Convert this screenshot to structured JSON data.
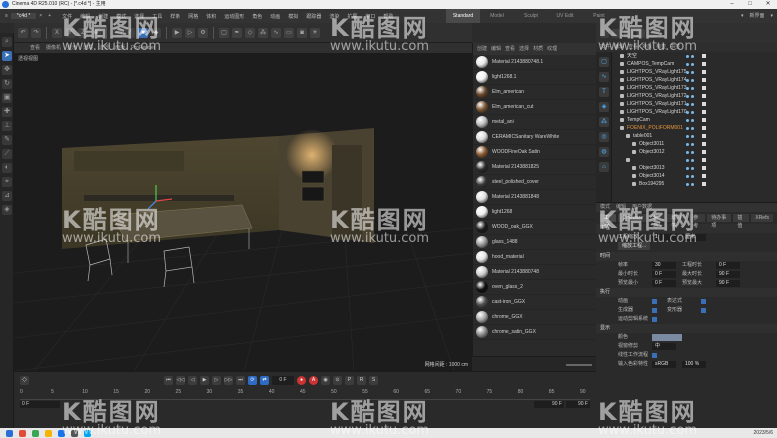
{
  "window": {
    "title": "Cinema 4D R25.010 (RC) - [*.c4d *] - 主用",
    "controls": [
      "–",
      "□",
      "✕"
    ]
  },
  "menubar": {
    "doc_tabs": [
      "≡",
      "*c4d *",
      "×",
      "+"
    ],
    "menus": [
      "文件",
      "编辑",
      "创建",
      "模式",
      "选择",
      "工具",
      "样条",
      "网格",
      "体积",
      "运动图形",
      "角色",
      "动画",
      "模拟",
      "跟踪器",
      "渲染",
      "扩展",
      "窗口",
      "帮助"
    ],
    "layouts": [
      "Standard",
      "Model",
      "Sculpt",
      "UV Edit",
      "Paint"
    ],
    "active_layout": "Standard",
    "right": [
      "▾",
      "新界面",
      "▾"
    ]
  },
  "toolbar": {
    "icons": [
      "cube-icon",
      "pen-icon",
      "subdivision-icon",
      "cloner-icon",
      "deformer-icon",
      "floor-icon",
      "camera-icon",
      "light-icon",
      "tag-icon",
      "render-icon",
      "render-view-icon",
      "render-settings-icon"
    ]
  },
  "viewport": {
    "menu": [
      "查看",
      "摄像机",
      "显示",
      "选项",
      "过滤",
      "面板",
      "ProRender"
    ],
    "label": "透视视图",
    "scale_text": "网格间距 : 1000 cm"
  },
  "material_manager": {
    "menu": [
      "创建",
      "编辑",
      "查看",
      "选择",
      "材质",
      "纹理"
    ],
    "materials": [
      {
        "name": "Material 2143880748.1",
        "color": "#e8e8e8"
      },
      {
        "name": "light1268.1",
        "color": "#f2f2f2"
      },
      {
        "name": "Elm_american",
        "color": "#6b4a2b"
      },
      {
        "name": "Elm_american_cut",
        "color": "#7a5634"
      },
      {
        "name": "metal_ani",
        "color": "#bdbdbd"
      },
      {
        "name": "CERAMICSanitary WareWhite",
        "color": "#dcdcdc"
      },
      {
        "name": "WOODFineOak Satin",
        "color": "#8a5a32"
      },
      {
        "name": "Material 2143881825",
        "color": "#2c2c2c"
      },
      {
        "name": "steel_polished_cover",
        "color": "#3a3a3a"
      },
      {
        "name": "Material 2143881848",
        "color": "#e0e0e0"
      },
      {
        "name": "light1268",
        "color": "#f0f0f0"
      },
      {
        "name": "WOOD_oak_GGX",
        "color": "#1d1d1d"
      },
      {
        "name": "glass_1488",
        "color": "#999999"
      },
      {
        "name": "hood_material",
        "color": "#e4e4e4"
      },
      {
        "name": "Material 2143880748",
        "color": "#cfcfcf"
      },
      {
        "name": "oven_glass_2",
        "color": "#111111"
      },
      {
        "name": "cast-iron_GGX",
        "color": "#505050"
      },
      {
        "name": "chrome_GGX",
        "color": "#a8a8a8"
      },
      {
        "name": "chrome_satin_GGX",
        "color": "#8c8c8c"
      }
    ]
  },
  "object_manager": {
    "menu": [
      "文件",
      "编辑",
      "查看",
      "对象",
      "标签",
      "书签"
    ],
    "objects": [
      {
        "name": "天空",
        "indent": 0,
        "orange": false
      },
      {
        "name": "CAMPOS_TempCam",
        "indent": 0,
        "orange": false
      },
      {
        "name": "LIGHTPOS_VRayLight175",
        "indent": 0,
        "orange": false
      },
      {
        "name": "LIGHTPOS_VRayLight174",
        "indent": 0,
        "orange": false
      },
      {
        "name": "LIGHTPOS_VRayLight173",
        "indent": 0,
        "orange": false
      },
      {
        "name": "LIGHTPOS_VRayLight172",
        "indent": 0,
        "orange": false
      },
      {
        "name": "LIGHTPOS_VRayLight171",
        "indent": 0,
        "orange": false
      },
      {
        "name": "LIGHTPOS_VRayLight170",
        "indent": 0,
        "orange": false
      },
      {
        "name": "TempCam",
        "indent": 0,
        "orange": false
      },
      {
        "name": "FOENIX_POLIFORM001",
        "indent": 0,
        "orange": true
      },
      {
        "name": "table001",
        "indent": 1,
        "orange": false
      },
      {
        "name": "Object3011",
        "indent": 2,
        "orange": false
      },
      {
        "name": "Object3012",
        "indent": 2,
        "orange": false
      },
      {
        "name": "",
        "indent": 1,
        "orange": false
      },
      {
        "name": "Object3013",
        "indent": 2,
        "orange": false
      },
      {
        "name": "Object3014",
        "indent": 2,
        "orange": false
      },
      {
        "name": "Box194295",
        "indent": 2,
        "orange": false
      }
    ]
  },
  "attributes": {
    "mode_menu": [
      "模式",
      "编辑",
      "用户数据"
    ],
    "tabs": [
      "工程",
      "Cineware",
      "信息",
      "动力学",
      "参考",
      "待办事项",
      "插值",
      "XRefs"
    ],
    "active_tab": "工程",
    "section_project": "工程",
    "project_scale_label": "工程缩放",
    "project_scale_value": "1",
    "project_scale_unit": "厘米",
    "scale_button": "缩放工程...",
    "section_time": "时间",
    "fps_label": "帧率",
    "fps_value": "30",
    "project_time_label": "工程时长",
    "project_time_value": "0 F",
    "min_time_label": "最小时长",
    "min_time_value": "0 F",
    "max_time_label": "最大时长",
    "max_time_value": "90 F",
    "preview_min_label": "预览最小",
    "preview_min_value": "0 F",
    "preview_max_label": "预览最大",
    "preview_max_value": "90 F",
    "section_exec": "执行",
    "anim_label": "动画",
    "expr_label": "表达式",
    "gen_label": "生成器",
    "deform_label": "变形器",
    "mograph_label": "运动剪辑系统",
    "section_display": "显示",
    "color_label": "颜色",
    "viewport_clip_label": "视窗修剪",
    "viewport_clip_value": "中",
    "linear_label": "线性工作流程",
    "color_profile_label": "输入色彩特性",
    "color_profile_value": "sRGB",
    "zoom_value": "100 %"
  },
  "timeline": {
    "current_frame": "0 F",
    "ruler": [
      "0",
      "5",
      "10",
      "15",
      "20",
      "25",
      "30",
      "35",
      "40",
      "45",
      "50",
      "55",
      "60",
      "65",
      "70",
      "75",
      "80",
      "85",
      "90"
    ],
    "start": "0 F",
    "end": "90 F",
    "end2": "90 F"
  },
  "taskbar": {
    "icons": [
      "#2a6fd6",
      "#e04b3a",
      "#3aa757",
      "#f5b400",
      "#1a73e8",
      "#555555",
      "#00a4ef"
    ],
    "time": "2023/5/6"
  },
  "watermark": {
    "text": "K酷图网",
    "url": "www.ikutu.com"
  }
}
